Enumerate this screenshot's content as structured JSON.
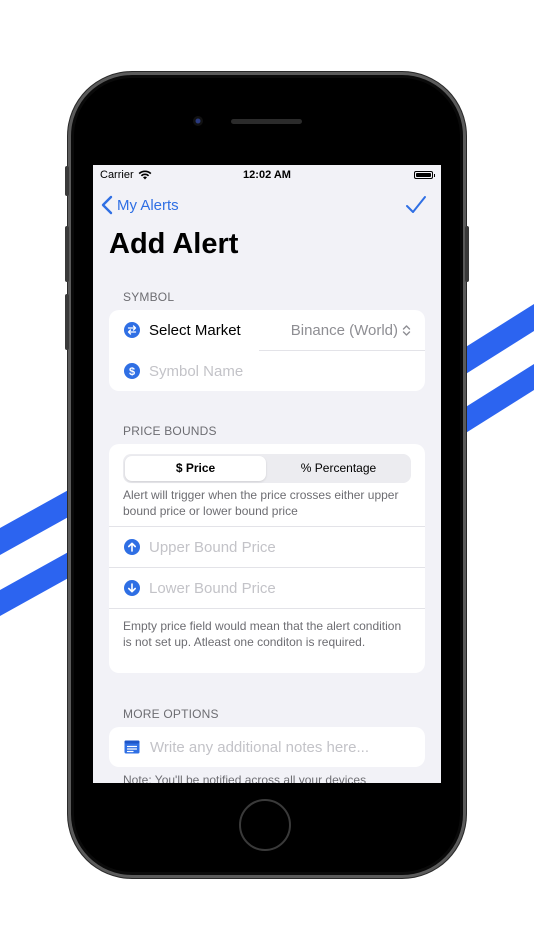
{
  "status_bar": {
    "carrier": "Carrier",
    "time": "12:02 AM"
  },
  "nav": {
    "back_label": "My Alerts"
  },
  "page": {
    "title": "Add Alert"
  },
  "symbol_section": {
    "header": "SYMBOL",
    "market_label": "Select Market",
    "market_value": "Binance (World)",
    "symbol_placeholder": "Symbol Name"
  },
  "price_section": {
    "header": "PRICE BOUNDS",
    "segments": [
      "$ Price",
      "% Percentage"
    ],
    "selected_segment": "$ Price",
    "hint": "Alert will trigger when the price crosses either upper bound price or lower bound price",
    "upper_placeholder": "Upper Bound Price",
    "lower_placeholder": "Lower Bound Price",
    "footer": "Empty price field would mean that the alert condition is not set up. Atleast one conditon is required."
  },
  "options_section": {
    "header": "MORE OPTIONS",
    "notes_placeholder": "Write any additional notes here...",
    "note": "Note: You'll be notified across all your devices"
  },
  "icons": {
    "back": "chevron-left-icon",
    "done": "checkmark-icon",
    "market": "arrows-swap-icon",
    "symbol": "dollar-circle-icon",
    "upper": "arrow-up-circle-icon",
    "lower": "arrow-down-circle-icon",
    "notes": "notes-icon"
  },
  "colors": {
    "accent": "#2f6fe4",
    "stripe": "#2c64f0"
  }
}
